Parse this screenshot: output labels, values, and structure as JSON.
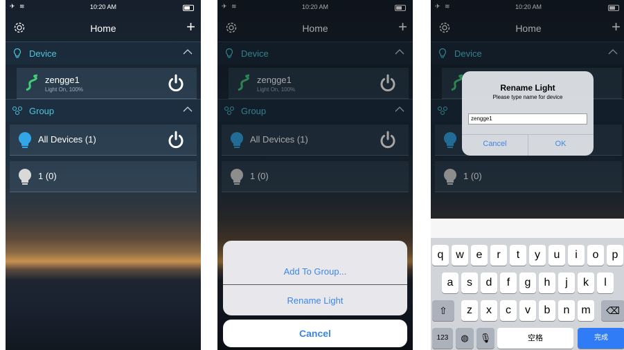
{
  "status": {
    "time": "10:20 AM"
  },
  "nav": {
    "title": "Home",
    "add_label": "+"
  },
  "device_section": {
    "label": "Device"
  },
  "device": {
    "name": "zengge1",
    "status": "Light On, 100%"
  },
  "group_section": {
    "label": "Group"
  },
  "groups": [
    {
      "name": "All Devices (1)"
    },
    {
      "name": "1 (0)"
    }
  ],
  "action_sheet": {
    "add_to_group": "Add To Group...",
    "rename_light": "Rename Light",
    "cancel": "Cancel"
  },
  "rename_dialog": {
    "title": "Rename Light",
    "message": "Please type name for device",
    "input_value": "zengge1",
    "cancel": "Cancel",
    "ok": "OK"
  },
  "keyboard": {
    "row1": [
      "q",
      "w",
      "e",
      "r",
      "t",
      "y",
      "u",
      "i",
      "o",
      "p"
    ],
    "row2": [
      "a",
      "s",
      "d",
      "f",
      "g",
      "h",
      "j",
      "k",
      "l"
    ],
    "row3": [
      "z",
      "x",
      "c",
      "v",
      "b",
      "n",
      "m"
    ],
    "numbers_key": "123",
    "space_key": "空格",
    "done_key": "完成"
  },
  "colors": {
    "accent": "#4fc6da",
    "ios_blue": "#3b86e8"
  }
}
